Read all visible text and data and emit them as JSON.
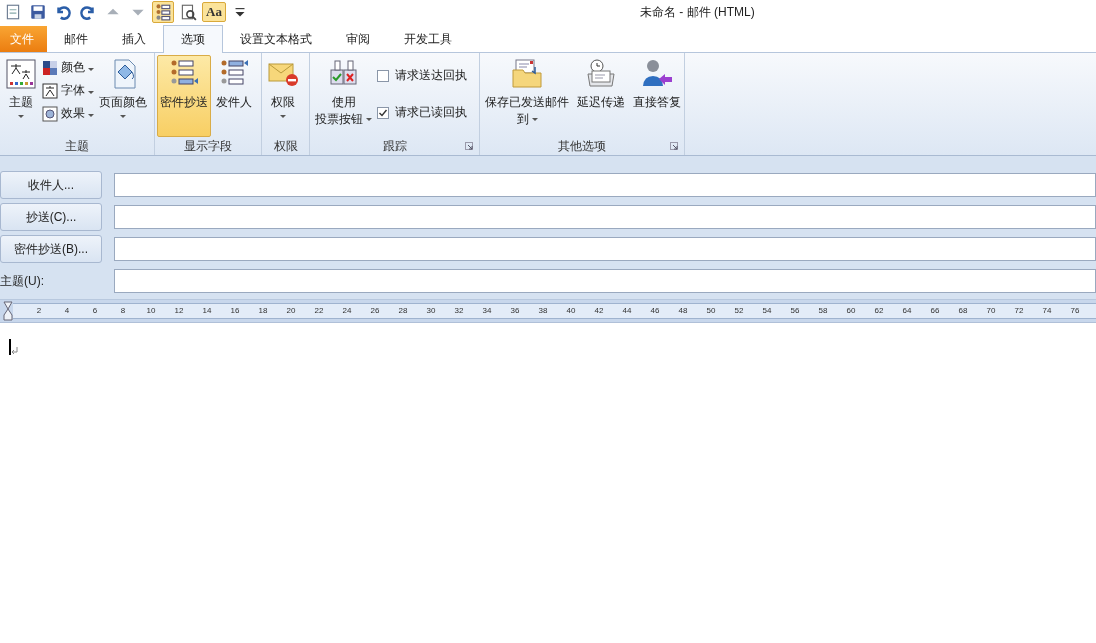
{
  "window": {
    "title": "未命名 - 邮件 (HTML)"
  },
  "quick_access": [
    {
      "kind": "icon",
      "selected": false
    },
    {
      "kind": "icon",
      "selected": false
    },
    {
      "kind": "icon",
      "selected": false
    },
    {
      "kind": "icon",
      "selected": false
    },
    {
      "kind": "icon",
      "selected": false
    },
    {
      "kind": "icon",
      "selected": false
    },
    {
      "kind": "icon",
      "selected": true
    },
    {
      "kind": "icon",
      "selected": false
    },
    {
      "kind": "text",
      "label": "Aa",
      "selected": true
    },
    {
      "kind": "menu",
      "selected": false
    }
  ],
  "tabs": [
    {
      "label": "文件",
      "kind": "file",
      "selected": false
    },
    {
      "label": "邮件",
      "kind": "tab",
      "selected": false
    },
    {
      "label": "插入",
      "kind": "tab",
      "selected": false
    },
    {
      "label": "选项",
      "kind": "tab",
      "selected": true
    },
    {
      "label": "设置文本格式",
      "kind": "tab",
      "selected": false
    },
    {
      "label": "审阅",
      "kind": "tab",
      "selected": false
    },
    {
      "label": "开发工具",
      "kind": "tab",
      "selected": false
    }
  ],
  "ribbon": {
    "groups": [
      {
        "label": "主题",
        "launcher": false,
        "items": [
          {
            "kind": "large",
            "lines": [
              "主题"
            ],
            "dropdown": true,
            "selected": false
          },
          {
            "kind": "stack",
            "items": [
              {
                "label": "颜色",
                "dropdown": true
              },
              {
                "label": "字体",
                "dropdown": true
              },
              {
                "label": "效果",
                "dropdown": true
              }
            ]
          },
          {
            "kind": "large",
            "lines": [
              "页面颜色"
            ],
            "dropdown": true,
            "selected": false
          }
        ]
      },
      {
        "label": "显示字段",
        "launcher": false,
        "items": [
          {
            "kind": "large",
            "lines": [
              "密件抄送"
            ],
            "dropdown": false,
            "selected": true
          },
          {
            "kind": "large",
            "lines": [
              "发件人"
            ],
            "dropdown": false,
            "selected": false
          }
        ]
      },
      {
        "label": "权限",
        "launcher": false,
        "items": [
          {
            "kind": "large",
            "lines": [
              "权限"
            ],
            "dropdown": true,
            "selected": false
          }
        ]
      },
      {
        "label": "跟踪",
        "launcher": true,
        "items": [
          {
            "kind": "large",
            "lines": [
              "使用",
              "投票按钮"
            ],
            "dropdown": true,
            "selected": false
          },
          {
            "kind": "checks",
            "items": [
              {
                "label": "请求送达回执",
                "checked": false
              },
              {
                "label": "请求已读回执",
                "checked": true
              }
            ]
          }
        ]
      },
      {
        "label": "其他选项",
        "launcher": true,
        "items": [
          {
            "kind": "large",
            "lines": [
              "保存已发送邮件",
              "到"
            ],
            "dropdown": true,
            "selected": false
          },
          {
            "kind": "large",
            "lines": [
              "延迟传递"
            ],
            "dropdown": false,
            "selected": false
          },
          {
            "kind": "large",
            "lines": [
              "直接答复"
            ],
            "dropdown": false,
            "selected": false
          }
        ]
      }
    ]
  },
  "header_fields": [
    {
      "kind": "button",
      "label": "收件人..."
    },
    {
      "kind": "button",
      "label": "抄送(C)..."
    },
    {
      "kind": "button",
      "label": "密件抄送(B)..."
    },
    {
      "kind": "label",
      "label": "主题(U):"
    }
  ],
  "ruler": {
    "marks": [
      "2",
      "4",
      "6",
      "8",
      "10",
      "12",
      "14",
      "16",
      "18",
      "20",
      "22",
      "24",
      "26",
      "28",
      "30",
      "32",
      "34",
      "36",
      "38",
      "40",
      "42",
      "44",
      "46",
      "48",
      "50",
      "52",
      "54",
      "56",
      "58",
      "60",
      "62",
      "64",
      "66",
      "68",
      "70",
      "72",
      "74",
      "76"
    ]
  }
}
